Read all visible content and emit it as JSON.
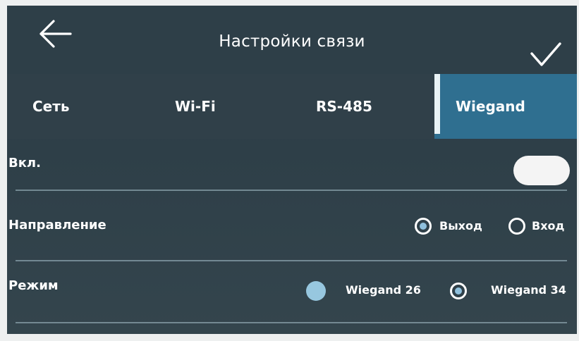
{
  "header": {
    "back_icon": "arrow-left-icon",
    "title": "Настройки связи",
    "confirm_icon": "check-icon"
  },
  "tabs": [
    {
      "label": "Сеть",
      "active": false
    },
    {
      "label": "Wi-Fi",
      "active": false
    },
    {
      "label": "RS-485",
      "active": false
    },
    {
      "label": "Wiegand",
      "active": true
    }
  ],
  "settings": {
    "enable": {
      "label": "Вкл.",
      "on": true
    },
    "direction": {
      "label": "Направление",
      "options": [
        {
          "label": "Выход",
          "selected": true
        },
        {
          "label": "Вход",
          "selected": false
        }
      ]
    },
    "mode": {
      "label": "Режим",
      "options": [
        {
          "label": "Wiegand 26",
          "selected": true
        },
        {
          "label": "Wiegand 34",
          "selected": false
        }
      ]
    }
  },
  "colors": {
    "background": "#2f4049",
    "active_tab": "#2f6f90",
    "accent": "#97c7df"
  }
}
